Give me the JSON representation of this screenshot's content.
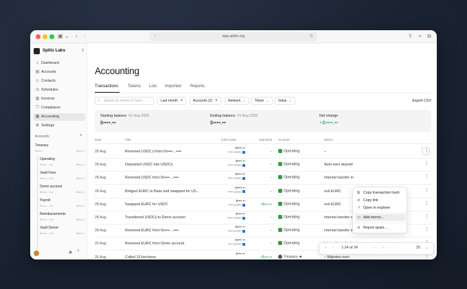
{
  "browser": {
    "url": "app.splits.org"
  },
  "sidebar": {
    "org_name": "Splits Labs",
    "nav": [
      {
        "label": "Dashboard",
        "icon": "dashboard-icon"
      },
      {
        "label": "Accounts",
        "icon": "accounts-icon"
      },
      {
        "label": "Contacts",
        "icon": "contacts-icon"
      },
      {
        "label": "Schedules",
        "icon": "schedules-icon"
      },
      {
        "label": "Invoices",
        "icon": "invoices-icon"
      },
      {
        "label": "Compliance",
        "icon": "compliance-icon"
      },
      {
        "label": "Accounting",
        "icon": "accounting-icon",
        "active": true
      },
      {
        "label": "Settings",
        "icon": "settings-icon"
      }
    ],
    "accounts_heading": "Accounts",
    "accounts": [
      {
        "name": "Treasury",
        "addr": "0x••••…",
        "bal": "$••••,••"
      },
      {
        "name": "Operating",
        "addr": "0x••••…••••",
        "bal": "$••••,••"
      },
      {
        "name": "Vault Fees",
        "addr": "0x••••…••••",
        "bal": "$••••,••"
      },
      {
        "name": "Demo account",
        "addr": "0x••••…••••",
        "bal": "$••••,••"
      },
      {
        "name": "Payroll",
        "addr": "0x••••…••••",
        "bal": "$••••,••"
      },
      {
        "name": "Reimbursements",
        "addr": "0x••••…••••",
        "bal": "$••••,••"
      },
      {
        "name": "Vault Owner",
        "addr": "0x••••…••••",
        "bal": "$••••,••"
      }
    ]
  },
  "main": {
    "title": "Accounting",
    "tabs": [
      "Transactions",
      "Tokens",
      "Lots",
      "Imported",
      "Reports"
    ],
    "search_placeholder": "Search by memo or hash...",
    "filters": {
      "period": "Last month",
      "accounts": "Accounts (2)",
      "network": "Network",
      "token": "Token",
      "value": "Value"
    },
    "export_label": "Export CSV",
    "summary": {
      "starting_label": "Starting balance",
      "starting_date": "01 Aug 2026",
      "starting_value": "$••••,••",
      "ending_label": "Ending balance",
      "ending_date": "31 Aug 2026",
      "ending_value": "$••••,••",
      "net_label": "Net change",
      "net_value": "+$••••,••"
    },
    "columns": [
      "Date",
      "Title",
      "USD value",
      "Gain/loss",
      "Account",
      "Memo"
    ],
    "rows": [
      {
        "date": "28 Aug",
        "title": "Received USDC ⟠ from 0x••••…••••",
        "usd1": "+$••••,••",
        "usd2": "••••• USDC",
        "coin": "#2775ca",
        "gain": "–",
        "account": "Operating",
        "memo": "–"
      },
      {
        "date": "28 Aug",
        "title": "Deposited USDC into USDC⟠",
        "usd1": "-$••••,••",
        "usd2": "-••••• USDC",
        "coin": "#2775ca",
        "gain": "–",
        "account": "Operating",
        "memo": "Auto-earn deposit"
      },
      {
        "date": "28 Aug",
        "title": "Received USDC from 0x••••…••••",
        "usd1": "+$••••,••",
        "usd2": "••••• USDC",
        "coin": "#2775ca",
        "gain": "–",
        "account": "Operating",
        "memo": "Internal transfer in"
      },
      {
        "date": "28 Aug",
        "title": "Bridged EURC to Base and swapped for US...",
        "usd1": "+$••••,••",
        "usd2": "••••• USDC",
        "coin": "#2775ca",
        "gain": "–",
        "account": "Operating",
        "memo": "exit EURC"
      },
      {
        "date": "28 Aug",
        "title": "Swapped EURC for USDC",
        "usd1": "$••••,••",
        "usd2": "-•••• EURC",
        "coin": "#2775ca",
        "gain": "+$•••,••",
        "gain_green": true,
        "account": "Operating",
        "memo": "exit EURC"
      },
      {
        "date": "28 Aug",
        "title": "Transferred USDC⟠ to Demo account",
        "usd1": "-$••••,••",
        "usd2": "-••••• USDC",
        "coin": "#2775ca",
        "gain": "–",
        "account": "Operating",
        "memo": "Internal transfer out"
      },
      {
        "date": "28 Aug",
        "title": "Received EURC from 0x••••…••••",
        "usd1": "+$••••,••",
        "usd2": "••••• EURC",
        "coin": "#2775ca",
        "gain": "–",
        "account": "Operating",
        "memo": "Internal transfer in"
      },
      {
        "date": "26 Aug",
        "title": "Received EURC from Demo account",
        "usd1": "+$••••,••",
        "usd2": "••••• EURC",
        "coin": "#2775ca",
        "gain": "–",
        "account": "Operating",
        "memo": "Internal transfer in"
      },
      {
        "date": "26 Aug",
        "title": "Called 19 functions",
        "usd1": "$••••,••",
        "usd2": "",
        "coin": "",
        "gain": "+$•••,••",
        "gain_green": true,
        "account": "Treasury ★",
        "treasury": true,
        "memo": "– Migrates earn"
      }
    ],
    "menu": [
      "Copy transaction hash",
      "Copy link",
      "Open in explorer",
      "Add memo...",
      "Report spam..."
    ],
    "pager": {
      "range": "1-24 of 24",
      "page_size": "25"
    }
  }
}
